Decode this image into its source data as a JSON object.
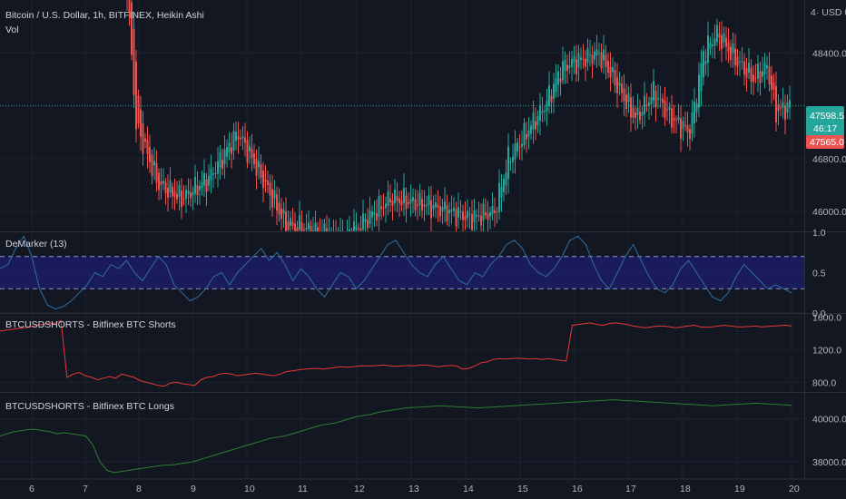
{
  "header": {
    "title": "Bitcoin / U.S. Dollar, 1h, BITFINEX, Heikin Ashi",
    "vol_label": "Vol",
    "currency_label": "4· USD 0"
  },
  "price_tags": {
    "last_price": "47598.5",
    "countdown": "46:17",
    "open_price": "47565.0",
    "last_color": "#26a69a",
    "open_color": "#ef5350"
  },
  "colors": {
    "background": "#131722",
    "grid": "#1e222d",
    "up": "#26a69a",
    "down": "#ef5350",
    "demarker_line": "#2e6ea5",
    "demarker_band": "#1e1e6e",
    "shorts_line": "#e53935",
    "longs_line": "#2e7d32"
  },
  "x_axis": {
    "ticks": [
      "6",
      "7",
      "8",
      "9",
      "10",
      "11",
      "12",
      "13",
      "14",
      "15",
      "16",
      "17",
      "18",
      "19",
      "20"
    ]
  },
  "chart_data": [
    {
      "type": "candlestick",
      "panel": "price",
      "y_ticks": [
        "48400.0",
        "46800.0",
        "46000.0"
      ],
      "ylim": [
        45700,
        49200
      ],
      "last_price": 47598.5,
      "candles_per_day": 24
    },
    {
      "type": "line",
      "panel": "demarker",
      "title": "DeMarker (13)",
      "y_ticks": [
        "1.0",
        "0.5",
        "0.0"
      ],
      "ylim": [
        0,
        1
      ],
      "overbought": 0.7,
      "oversold": 0.3,
      "series": [
        {
          "name": "DeMarker (13)",
          "values": [
            0.55,
            0.6,
            0.8,
            0.95,
            0.7,
            0.3,
            0.1,
            0.05,
            0.08,
            0.15,
            0.25,
            0.35,
            0.5,
            0.45,
            0.6,
            0.55,
            0.65,
            0.5,
            0.4,
            0.55,
            0.7,
            0.6,
            0.35,
            0.25,
            0.15,
            0.2,
            0.3,
            0.45,
            0.5,
            0.35,
            0.5,
            0.6,
            0.7,
            0.8,
            0.65,
            0.75,
            0.6,
            0.4,
            0.55,
            0.45,
            0.3,
            0.2,
            0.35,
            0.5,
            0.45,
            0.3,
            0.4,
            0.55,
            0.7,
            0.85,
            0.9,
            0.75,
            0.6,
            0.5,
            0.45,
            0.6,
            0.7,
            0.55,
            0.4,
            0.35,
            0.5,
            0.45,
            0.6,
            0.7,
            0.85,
            0.9,
            0.8,
            0.6,
            0.5,
            0.45,
            0.55,
            0.7,
            0.9,
            0.95,
            0.85,
            0.6,
            0.4,
            0.3,
            0.5,
            0.7,
            0.85,
            0.65,
            0.45,
            0.3,
            0.25,
            0.35,
            0.55,
            0.65,
            0.5,
            0.35,
            0.2,
            0.15,
            0.25,
            0.45,
            0.6,
            0.5,
            0.4,
            0.3,
            0.35,
            0.3,
            0.25
          ]
        }
      ]
    },
    {
      "type": "line",
      "panel": "shorts",
      "title": "BTCUSDSHORTS - Bitfinex BTC Shorts",
      "y_ticks": [
        "1600.0",
        "1200.0",
        "800.0"
      ],
      "ylim": [
        680,
        1640
      ],
      "series": [
        {
          "name": "BTCUSDSHORTS",
          "values": [
            1430,
            1440,
            1450,
            1460,
            1470,
            1480,
            1500,
            1510,
            1520,
            1525,
            1560,
            860,
            900,
            920,
            880,
            860,
            830,
            850,
            870,
            850,
            900,
            880,
            860,
            820,
            800,
            780,
            760,
            750,
            790,
            800,
            780,
            770,
            760,
            830,
            860,
            870,
            900,
            910,
            900,
            880,
            890,
            900,
            910,
            900,
            890,
            880,
            900,
            930,
            940,
            950,
            960,
            965,
            970,
            960,
            970,
            980,
            990,
            985,
            990,
            1000,
            1000,
            1000,
            1005,
            1010,
            1000,
            995,
            1000,
            1005,
            1000,
            1010,
            1010,
            1000,
            990,
            1000,
            1005,
            1000,
            960,
            970,
            1000,
            1040,
            1050,
            1080,
            1090,
            1085,
            1090,
            1095,
            1090,
            1085,
            1090,
            1080,
            1090,
            1080,
            1070,
            1060,
            1500,
            1510,
            1520,
            1530,
            1510,
            1500,
            1520,
            1530,
            1520,
            1510,
            1490,
            1480,
            1470,
            1480,
            1490,
            1490,
            1480,
            1470,
            1480,
            1490,
            1500,
            1480,
            1475,
            1480,
            1490,
            1500,
            1490,
            1480,
            1480,
            1485,
            1490,
            1480,
            1485,
            1490,
            1495,
            1500,
            1490
          ]
        }
      ]
    },
    {
      "type": "line",
      "panel": "longs",
      "title": "BTCUSDSHORTS - Bitfinex BTC Longs",
      "y_ticks": [
        "40000.0",
        "38000.0"
      ],
      "ylim": [
        37200,
        41200
      ],
      "series": [
        {
          "name": "BTC Longs",
          "values": [
            39200,
            39300,
            39400,
            39450,
            39500,
            39500,
            39450,
            39400,
            39300,
            39350,
            39300,
            39250,
            39200,
            38800,
            38000,
            37600,
            37500,
            37550,
            37600,
            37650,
            37700,
            37750,
            37800,
            37850,
            37850,
            37900,
            37950,
            38000,
            38100,
            38200,
            38300,
            38400,
            38500,
            38600,
            38700,
            38800,
            38900,
            39000,
            39100,
            39150,
            39200,
            39300,
            39400,
            39500,
            39600,
            39700,
            39750,
            39800,
            39900,
            40000,
            40100,
            40150,
            40200,
            40300,
            40350,
            40400,
            40450,
            40500,
            40520,
            40540,
            40560,
            40580,
            40600,
            40580,
            40560,
            40540,
            40520,
            40500,
            40520,
            40540,
            40560,
            40580,
            40600,
            40620,
            40640,
            40660,
            40680,
            40700,
            40720,
            40740,
            40760,
            40780,
            40800,
            40820,
            40840,
            40860,
            40880,
            40860,
            40840,
            40820,
            40800,
            40780,
            40760,
            40740,
            40720,
            40700,
            40680,
            40660,
            40640,
            40620,
            40600,
            40620,
            40640,
            40660,
            40680,
            40700,
            40720,
            40700,
            40680,
            40660,
            40640,
            40620
          ]
        }
      ]
    }
  ]
}
